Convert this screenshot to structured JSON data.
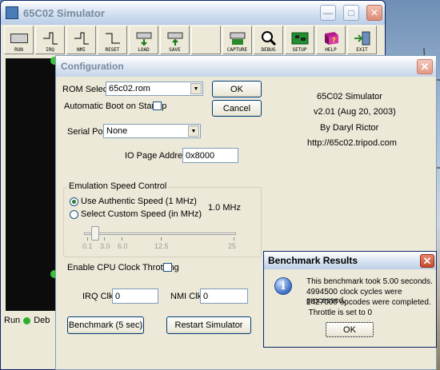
{
  "main_window": {
    "title": "65C02 Simulator",
    "toolbar": [
      {
        "label": "RUN",
        "icon": "chip-icon"
      },
      {
        "label": "IRQ",
        "icon": "irq-icon"
      },
      {
        "label": "NMI",
        "icon": "nmi-icon"
      },
      {
        "label": "RESET",
        "icon": "reset-icon"
      },
      {
        "label": "LOAD",
        "icon": "load-icon"
      },
      {
        "label": "SAVE",
        "icon": "save-icon"
      },
      {
        "label": "",
        "icon": "blank"
      },
      {
        "label": "CAPTURE",
        "icon": "capture-icon"
      },
      {
        "label": "DEBUG",
        "icon": "magnifier-icon"
      },
      {
        "label": "SETUP",
        "icon": "circuit-board-icon"
      },
      {
        "label": "HELP",
        "icon": "help-book-icon"
      },
      {
        "label": "EXIT",
        "icon": "exit-door-icon"
      }
    ],
    "status": {
      "run_label": "Run",
      "deb_label": "Deb"
    }
  },
  "config": {
    "title": "Configuration",
    "rom_select_label": "ROM Select:",
    "rom_value": "65c02.rom",
    "ok_label": "OK",
    "cancel_label": "Cancel",
    "auto_boot_label": "Automatic Boot on Startup",
    "serial_port_label": "Serial Port:",
    "serial_port_value": "None",
    "io_page_label": "IO Page Address",
    "io_page_value": "0x8000",
    "about": {
      "name": "65C02 Simulator",
      "version": "v2.01 (Aug 20, 2003)",
      "author": "By Daryl Rictor",
      "url": "http://65c02.tripod.com"
    },
    "speed_group": {
      "title": "Emulation Speed Control",
      "authentic_label": "Use Authentic Speed (1 MHz)",
      "custom_label": "Select Custom Speed (in MHz)",
      "speed_readout": "1.0 MHz",
      "slider_ticks": [
        "0.1",
        "3.0",
        "6.0",
        "12.5",
        "25"
      ],
      "slider_value": "1.0"
    },
    "throttle_label": "Enable CPU Clock Throttling",
    "irq_label": "IRQ Clk:",
    "irq_value": "0",
    "nmi_label": "NMI Clk:",
    "nmi_value": "0",
    "benchmark_button": "Benchmark (5 sec)",
    "restart_button": "Restart Simulator"
  },
  "benchmark": {
    "title": "Benchmark Results",
    "lines": [
      "This benchmark took 5.00 seconds.",
      "4994500 clock cycles were processed.",
      "1427000 opcodes were completed.",
      " Throttle is set to 0"
    ],
    "ok_label": "OK"
  }
}
